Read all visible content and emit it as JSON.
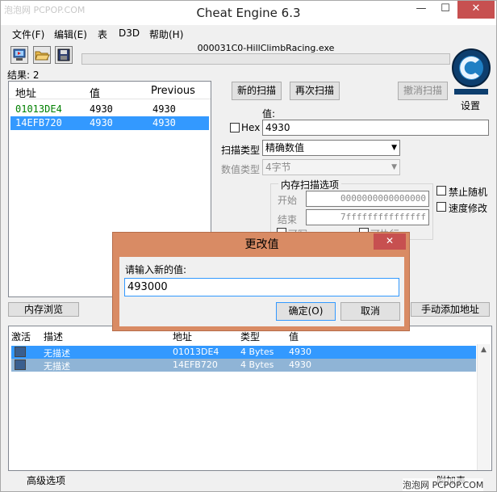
{
  "window": {
    "title": "Cheat Engine 6.3",
    "watermark_top": "泡泡网 PCPOP.COM",
    "min_glyph": "—",
    "max_glyph": "☐",
    "close_glyph": "✕"
  },
  "menu": [
    "文件(F)",
    "编辑(E)",
    "表",
    "D3D",
    "帮助(H)"
  ],
  "process": {
    "name": "000031C0-HillClimbRacing.exe",
    "progress": 0
  },
  "settings_label": "设置",
  "results": {
    "label": "结果: 2",
    "columns": [
      "地址",
      "值",
      "Previous"
    ],
    "rows": [
      {
        "address": "01013DE4",
        "value": "4930",
        "previous": "4930"
      },
      {
        "address": "14EFB720",
        "value": "4930",
        "previous": "4930"
      }
    ]
  },
  "scan": {
    "new_scan": "新的扫描",
    "next_scan": "再次扫描",
    "undo_scan": "撤消扫描",
    "value_label": "值:",
    "hex_label": "Hex",
    "value_input": "4930",
    "scan_type_label": "扫描类型",
    "scan_type": "精确数值",
    "value_type_label": "数值类型",
    "value_type": "4字节",
    "mem_options_title": "内存扫描选项",
    "start_label": "开始",
    "start_value": "0000000000000000",
    "end_label": "结束",
    "end_value": "7fffffffffffffff",
    "writable_label": "可写",
    "executable_label": "可执行",
    "no_random_label": "禁止随机",
    "speed_hack_label": "速度修改"
  },
  "buttons": {
    "memory_view": "内存浏览",
    "add_manual": "手动添加地址"
  },
  "address_table": {
    "columns": [
      "激活",
      "描述",
      "地址",
      "类型",
      "值"
    ],
    "rows": [
      {
        "description": "无描述",
        "address": "01013DE4",
        "type": "4 Bytes",
        "value": "4930"
      },
      {
        "description": "无描述",
        "address": "14EFB720",
        "type": "4 Bytes",
        "value": "4930"
      }
    ],
    "scroll_up_glyph": "▲"
  },
  "footer": {
    "advanced": "高级选项",
    "extra": "附加表",
    "watermark": "泡泡网 PCPOP.COM"
  },
  "dialog": {
    "title": "更改值",
    "prompt": "请输入新的值:",
    "input_value": "493000",
    "ok": "确定(O)",
    "cancel": "取消",
    "close_glyph": "✕"
  },
  "colors": {
    "selection": "#3399ff",
    "dialog_frame": "#d98b64",
    "close_red": "#c75050",
    "address_green": "#008000"
  }
}
